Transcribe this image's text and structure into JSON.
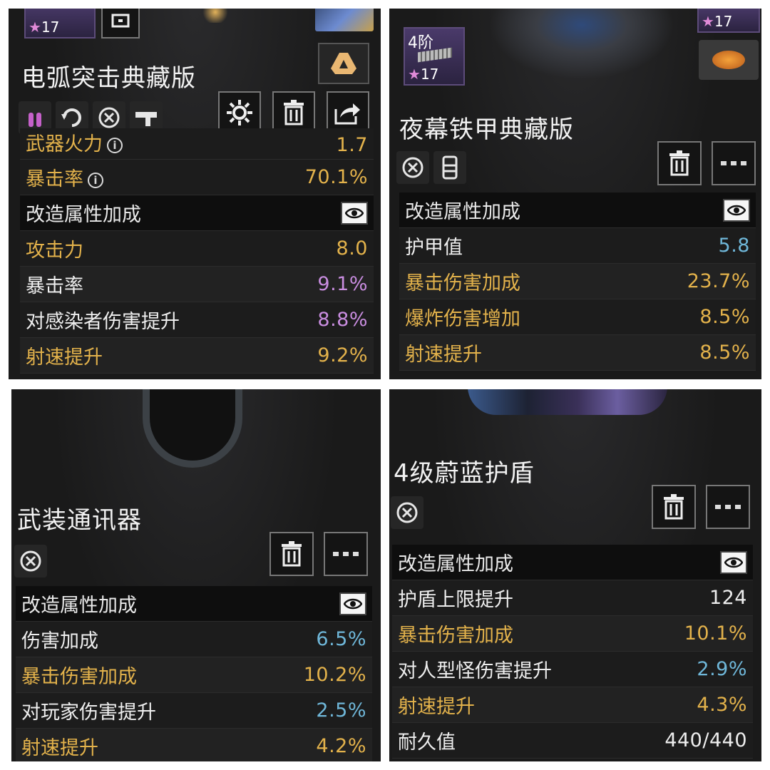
{
  "panels": [
    {
      "title": "电弧突击典藏版",
      "item_stars": "17",
      "rows_top": [
        {
          "label": "武器火力",
          "value": "1.7",
          "label_color": "gold",
          "value_color": "gold",
          "info": true
        },
        {
          "label": "暴击率",
          "value": "70.1%",
          "label_color": "gold",
          "value_color": "gold",
          "info": true
        }
      ],
      "header": "改造属性加成",
      "rows": [
        {
          "label": "攻击力",
          "value": "8.0",
          "label_color": "gold",
          "value_color": "gold"
        },
        {
          "label": "暴击率",
          "value": "9.1%",
          "label_color": "white",
          "value_color": "purple"
        },
        {
          "label": "对感染者伤害提升",
          "value": "8.8%",
          "label_color": "white",
          "value_color": "purple"
        },
        {
          "label": "射速提升",
          "value": "9.2%",
          "label_color": "gold",
          "value_color": "gold"
        }
      ]
    },
    {
      "title": "夜幕铁甲典藏版",
      "item_tier": "4阶",
      "item_stars": "17",
      "corner_stars": "17",
      "header": "改造属性加成",
      "rows": [
        {
          "label": "护甲值",
          "value": "5.8",
          "label_color": "white",
          "value_color": "blue"
        },
        {
          "label": "暴击伤害加成",
          "value": "23.7%",
          "label_color": "gold",
          "value_color": "gold"
        },
        {
          "label": "爆炸伤害增加",
          "value": "8.5%",
          "label_color": "gold",
          "value_color": "gold"
        },
        {
          "label": "射速提升",
          "value": "8.5%",
          "label_color": "gold",
          "value_color": "gold"
        }
      ]
    },
    {
      "title": "武装通讯器",
      "header": "改造属性加成",
      "rows": [
        {
          "label": "伤害加成",
          "value": "6.5%",
          "label_color": "white",
          "value_color": "blue"
        },
        {
          "label": "暴击伤害加成",
          "value": "10.2%",
          "label_color": "gold",
          "value_color": "gold"
        },
        {
          "label": "对玩家伤害提升",
          "value": "2.5%",
          "label_color": "white",
          "value_color": "blue"
        },
        {
          "label": "射速提升",
          "value": "4.2%",
          "label_color": "gold",
          "value_color": "gold"
        }
      ]
    },
    {
      "title": "4级蔚蓝护盾",
      "header": "改造属性加成",
      "rows": [
        {
          "label": "护盾上限提升",
          "value": "124",
          "label_color": "white",
          "value_color": "white"
        },
        {
          "label": "暴击伤害加成",
          "value": "10.1%",
          "label_color": "gold",
          "value_color": "gold"
        },
        {
          "label": "对人型怪伤害提升",
          "value": "2.9%",
          "label_color": "white",
          "value_color": "blue"
        },
        {
          "label": "射速提升",
          "value": "4.3%",
          "label_color": "gold",
          "value_color": "gold"
        },
        {
          "label": "耐久值",
          "value": "440/440",
          "label_color": "white",
          "value_color": "white"
        }
      ]
    }
  ],
  "icons": {
    "settings": "gear-icon",
    "delete": "trash-icon",
    "share": "share-icon",
    "more": "more-icon",
    "eye": "eye-icon",
    "info": "info-icon",
    "drive": "drive-icon",
    "frame": "frame-icon"
  }
}
